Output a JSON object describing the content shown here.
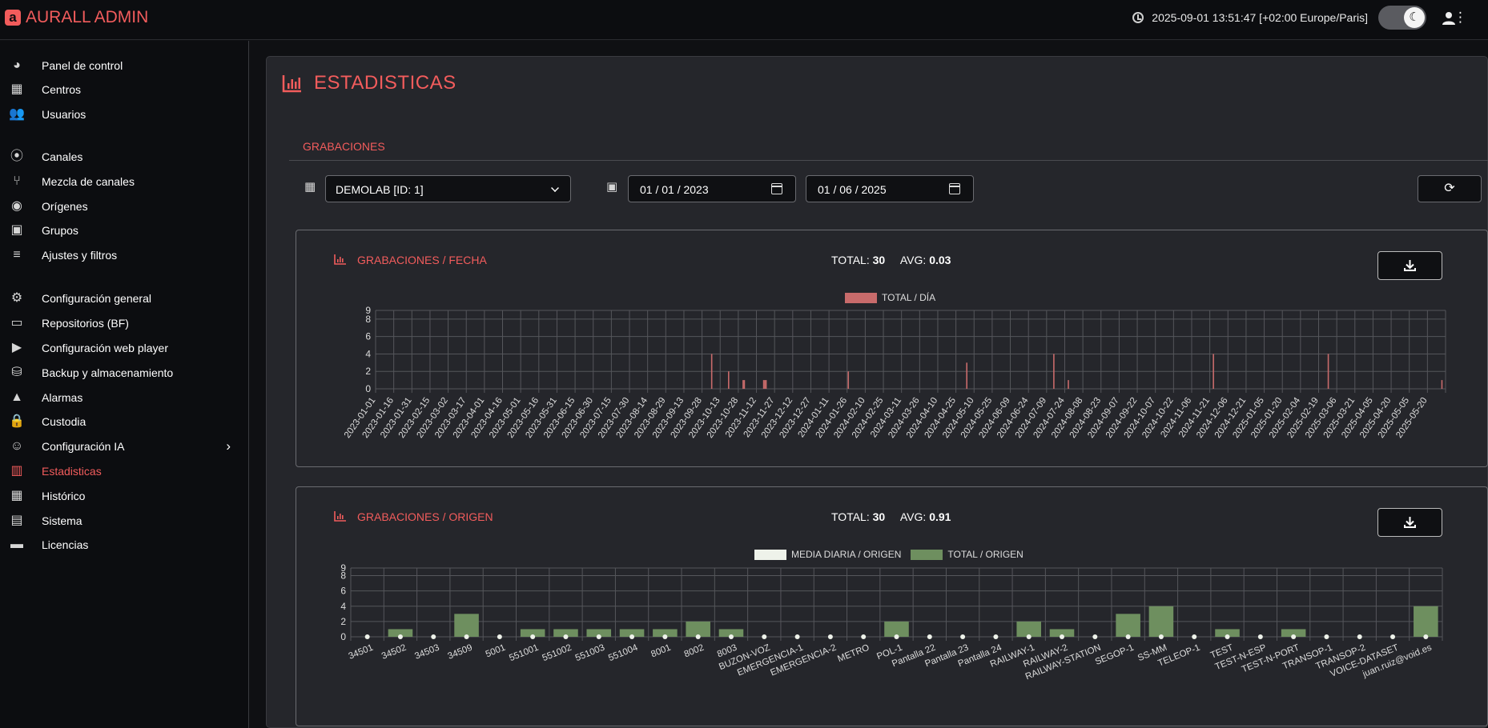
{
  "header": {
    "brand_logo": "a",
    "brand": "AURALL ADMIN",
    "datetime": "2025-09-01 13:51:47 [+02:00 Europe/Paris]",
    "theme_icon": "☾"
  },
  "sidebar": {
    "items": [
      {
        "label": "Panel de control",
        "icon": "◕"
      },
      {
        "label": "Centros",
        "icon": "▦"
      },
      {
        "label": "Usuarios",
        "icon": "👥"
      },
      {
        "label": "Canales",
        "icon": "⦿"
      },
      {
        "label": "Mezcla de canales",
        "icon": "⑂"
      },
      {
        "label": "Orígenes",
        "icon": "◉"
      },
      {
        "label": "Grupos",
        "icon": "▣"
      },
      {
        "label": "Ajustes y filtros",
        "icon": "≡"
      },
      {
        "label": "Configuración general",
        "icon": "⚙"
      },
      {
        "label": "Repositorios (BF)",
        "icon": "▭"
      },
      {
        "label": "Configuración web player",
        "icon": "▶"
      },
      {
        "label": "Backup y almacenamiento",
        "icon": "⛁"
      },
      {
        "label": "Alarmas",
        "icon": "▲"
      },
      {
        "label": "Custodia",
        "icon": "🔒"
      },
      {
        "label": "Configuración IA",
        "icon": "☺"
      },
      {
        "label": "Estadisticas",
        "icon": "▥"
      },
      {
        "label": "Histórico",
        "icon": "▦"
      },
      {
        "label": "Sistema",
        "icon": "▤"
      },
      {
        "label": "Licencias",
        "icon": "▬"
      }
    ],
    "chevron": "›"
  },
  "page": {
    "title": "ESTADISTICAS",
    "tab": "GRABACIONES"
  },
  "filters": {
    "center_icon": "▦",
    "calendar_icon": "▣",
    "center": "DEMOLAB [ID: 1]",
    "date_from": "01 / 01 / 2023",
    "date_to": "01 / 06 / 2025",
    "refresh_icon": "⟳"
  },
  "chart1": {
    "title": "GRABACIONES / FECHA",
    "total_label": "TOTAL:",
    "total": "30",
    "avg_label": "AVG:",
    "avg": "0.03",
    "legend": "TOTAL / DÍA",
    "color": "#c86b6b"
  },
  "chart2": {
    "title": "GRABACIONES / ORIGEN",
    "total_label": "TOTAL:",
    "total": "30",
    "avg_label": "AVG:",
    "avg": "0.91",
    "legend_avg": "MEDIA DIARIA / ORIGEN",
    "legend_total": "TOTAL / ORIGEN",
    "bar_color": "#6e8f5f",
    "avg_color": "#eef2ea"
  },
  "chart_data": [
    {
      "type": "bar",
      "title": "GRABACIONES / FECHA",
      "ylim": [
        0,
        9
      ],
      "yticks": [
        0,
        2,
        4,
        6,
        8,
        9
      ],
      "grid": true,
      "legend_position": "top-center",
      "categories": [
        "2023-01-01",
        "2023-01-16",
        "2023-01-31",
        "2023-02-15",
        "2023-03-02",
        "2023-03-17",
        "2023-04-01",
        "2023-04-16",
        "2023-05-01",
        "2023-05-16",
        "2023-05-31",
        "2023-06-15",
        "2023-06-30",
        "2023-07-15",
        "2023-07-30",
        "2023-08-14",
        "2023-08-29",
        "2023-09-13",
        "2023-09-28",
        "2023-10-13",
        "2023-10-28",
        "2023-11-12",
        "2023-11-27",
        "2023-12-12",
        "2023-12-27",
        "2024-01-11",
        "2024-01-26",
        "2024-02-10",
        "2024-02-25",
        "2024-03-11",
        "2024-03-26",
        "2024-04-10",
        "2024-04-25",
        "2024-05-10",
        "2024-05-25",
        "2024-06-09",
        "2024-06-24",
        "2024-07-09",
        "2024-07-24",
        "2024-08-08",
        "2024-08-23",
        "2024-09-07",
        "2024-09-22",
        "2024-10-07",
        "2024-10-22",
        "2024-11-06",
        "2024-11-21",
        "2024-12-06",
        "2024-12-21",
        "2025-01-05",
        "2025-01-20",
        "2025-02-04",
        "2025-02-19",
        "2025-03-06",
        "2025-03-21",
        "2025-04-05",
        "2025-04-20",
        "2025-05-05",
        "2025-05-20"
      ],
      "series": [
        {
          "name": "TOTAL / DÍA",
          "points": [
            {
              "x": "2023-10-06",
              "y": 4
            },
            {
              "x": "2023-10-20",
              "y": 2
            },
            {
              "x": "2023-11-01",
              "y": 1
            },
            {
              "x": "2023-11-02",
              "y": 1
            },
            {
              "x": "2023-11-18",
              "y": 1
            },
            {
              "x": "2023-11-19",
              "y": 1
            },
            {
              "x": "2023-11-20",
              "y": 1
            },
            {
              "x": "2024-01-27",
              "y": 2
            },
            {
              "x": "2024-05-04",
              "y": 3
            },
            {
              "x": "2024-07-15",
              "y": 4
            },
            {
              "x": "2024-07-27",
              "y": 1
            },
            {
              "x": "2024-11-24",
              "y": 4
            },
            {
              "x": "2025-02-27",
              "y": 4
            },
            {
              "x": "2025-06-01",
              "y": 1
            }
          ]
        }
      ]
    },
    {
      "type": "bar",
      "title": "GRABACIONES / ORIGEN",
      "ylim": [
        0,
        9
      ],
      "yticks": [
        0,
        2,
        4,
        6,
        8,
        9
      ],
      "grid": true,
      "legend_position": "top-center",
      "categories": [
        "34501",
        "34502",
        "34503",
        "34509",
        "5001",
        "551001",
        "551002",
        "551003",
        "551004",
        "8001",
        "8002",
        "8003",
        "BUZON-VOZ",
        "EMERGENCIA-1",
        "EMERGENCIA-2",
        "METRO",
        "POL-1",
        "Pantalla 22",
        "Pantalla 23",
        "Pantalla 24",
        "RAILWAY-1",
        "RAILWAY-2",
        "RAILWAY-STATION",
        "SEGOP-1",
        "SS-MM",
        "TELEOP-1",
        "TEST",
        "TEST-N-ESP",
        "TEST-N-PORT",
        "TRANSOP-1",
        "TRANSOP-2",
        "VOICE-DATASET",
        "juan.ruiz@void.es"
      ],
      "series": [
        {
          "name": "MEDIA DIARIA / ORIGEN",
          "values": [
            0,
            0,
            0,
            0,
            0,
            0,
            0,
            0,
            0,
            0,
            0,
            0,
            0,
            0,
            0,
            0,
            0,
            0,
            0,
            0,
            0,
            0,
            0,
            0,
            0,
            0,
            0,
            0,
            0,
            0,
            0,
            0,
            0
          ]
        },
        {
          "name": "TOTAL / ORIGEN",
          "values": [
            0,
            1,
            0,
            3,
            0,
            1,
            1,
            1,
            1,
            1,
            2,
            1,
            0,
            0,
            0,
            0,
            2,
            0,
            0,
            0,
            2,
            1,
            0,
            3,
            4,
            0,
            1,
            0,
            1,
            0,
            0,
            0,
            4
          ]
        }
      ]
    }
  ]
}
